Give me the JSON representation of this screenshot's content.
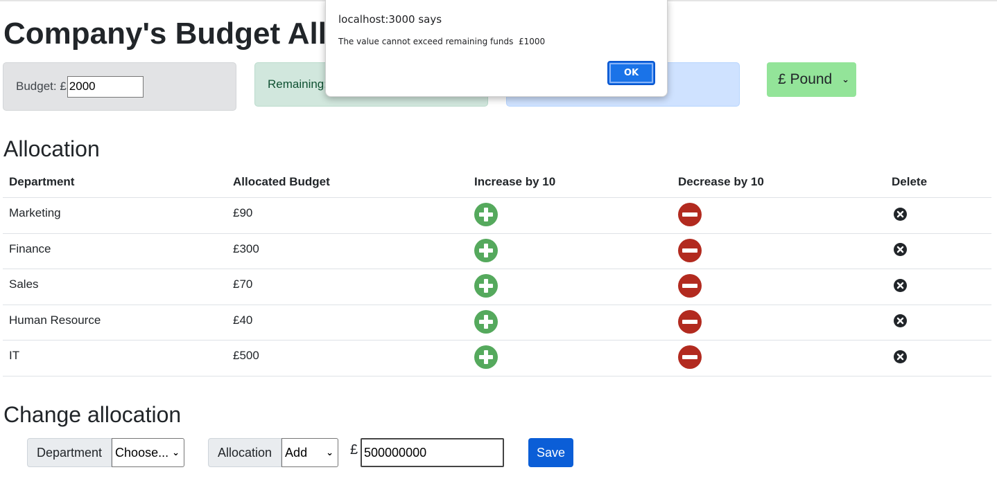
{
  "header": {
    "title": "Company's Budget Allocation"
  },
  "budget_card": {
    "label": "Budget: £",
    "value": "2000"
  },
  "remaining_card": {
    "label": "Remaining: £1000"
  },
  "spent_card": {
    "label": ""
  },
  "currency": {
    "selected": "£ Pound"
  },
  "allocation": {
    "title": "Allocation",
    "columns": [
      "Department",
      "Allocated Budget",
      "Increase by 10",
      "Decrease by 10",
      "Delete"
    ],
    "rows": [
      {
        "department": "Marketing",
        "budget": "£90"
      },
      {
        "department": "Finance",
        "budget": "£300"
      },
      {
        "department": "Sales",
        "budget": "£70"
      },
      {
        "department": "Human Resource",
        "budget": "£40"
      },
      {
        "department": "IT",
        "budget": "£500"
      }
    ]
  },
  "change": {
    "title": "Change allocation",
    "department_label": "Department",
    "department_value": "Choose...",
    "allocation_label": "Allocation",
    "allocation_value": "Add",
    "currency_symbol": "£",
    "amount": "500000000",
    "save_label": "Save"
  },
  "dialog": {
    "title": "localhost:3000 says",
    "message": "The value cannot exceed remaining funds  £1000",
    "ok_label": "OK"
  },
  "icons": {
    "increase": "plus-circle-icon",
    "decrease": "minus-circle-icon",
    "delete": "x-circle-icon"
  },
  "colors": {
    "increase": "#55a95d",
    "decrease": "#b22a1f",
    "delete": "#212529",
    "save": "#0b5ed7",
    "currency_bg": "#93e499",
    "dialog_ok": "#1a73e8"
  }
}
